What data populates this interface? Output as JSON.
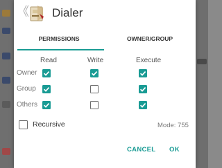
{
  "background": {
    "mode_hint": "mode"
  },
  "dialog": {
    "title": "Dialer",
    "back_glyph": "《",
    "tabs": [
      {
        "label": "PERMISSIONS",
        "active": true
      },
      {
        "label": "OWNER/GROUP",
        "active": false
      }
    ],
    "columns": [
      "Read",
      "Write",
      "Execute"
    ],
    "rows": [
      {
        "label": "Owner",
        "read": true,
        "write": true,
        "execute": true
      },
      {
        "label": "Group",
        "read": true,
        "write": false,
        "execute": true
      },
      {
        "label": "Others",
        "read": true,
        "write": false,
        "execute": true
      }
    ],
    "recursive": {
      "label": "Recursive",
      "checked": false
    },
    "mode_text": "Mode: 755",
    "buttons": {
      "cancel": "CANCEL",
      "ok": "OK"
    }
  },
  "colors": {
    "accent": "#199b94",
    "text": "#333333",
    "muted": "#757575"
  },
  "icons": {
    "back": "chevron-left-double-icon",
    "app": "dialer-app-icon",
    "check": "checkmark-icon"
  }
}
